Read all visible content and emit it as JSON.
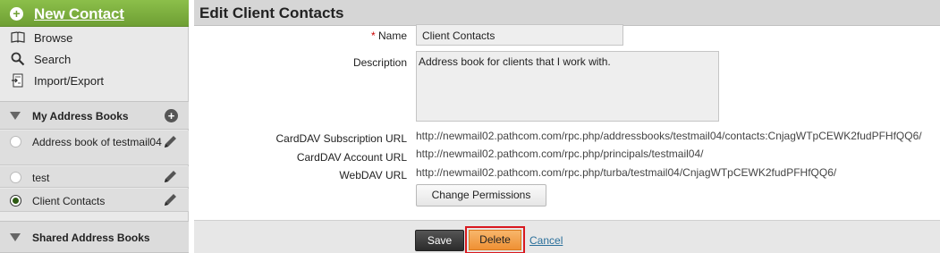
{
  "sidebar": {
    "new_contact": "New Contact",
    "menu": [
      {
        "label": "Browse",
        "icon": "book-icon"
      },
      {
        "label": "Search",
        "icon": "search-icon"
      },
      {
        "label": "Import/Export",
        "icon": "import-export-icon"
      }
    ],
    "my_address_books": {
      "label": "My Address Books",
      "books": [
        {
          "label": "Address book of testmail04",
          "selected": false
        },
        {
          "label": "test",
          "selected": false
        },
        {
          "label": "Client Contacts",
          "selected": true
        }
      ]
    },
    "shared_address_books": {
      "label": "Shared Address Books"
    }
  },
  "main": {
    "title": "Edit Client Contacts",
    "form": {
      "name_required_marker": "*",
      "name_label": "Name",
      "name_value": "Client Contacts",
      "description_label": "Description",
      "description_value": "Address book for clients that I work with.",
      "carddav_subscription_label": "CardDAV Subscription URL",
      "carddav_subscription_url": "http://newmail02.pathcom.com/rpc.php/addressbooks/testmail04/contacts:CnjagWTpCEWK2fudPFHfQQ6/",
      "carddav_account_label": "CardDAV Account URL",
      "carddav_account_url": "http://newmail02.pathcom.com/rpc.php/principals/testmail04/",
      "webdav_label": "WebDAV URL",
      "webdav_url": "http://newmail02.pathcom.com/rpc.php/turba/testmail04/CnjagWTpCEWK2fudPFHfQQ6/",
      "change_permissions": "Change Permissions"
    },
    "actions": {
      "save": "Save",
      "delete": "Delete",
      "cancel": "Cancel"
    }
  },
  "colors": {
    "new_contact_bg": "#7cad3e",
    "delete_button": "#ef9a3e",
    "highlight_border": "#d9181f",
    "link": "#2a6f9a"
  }
}
